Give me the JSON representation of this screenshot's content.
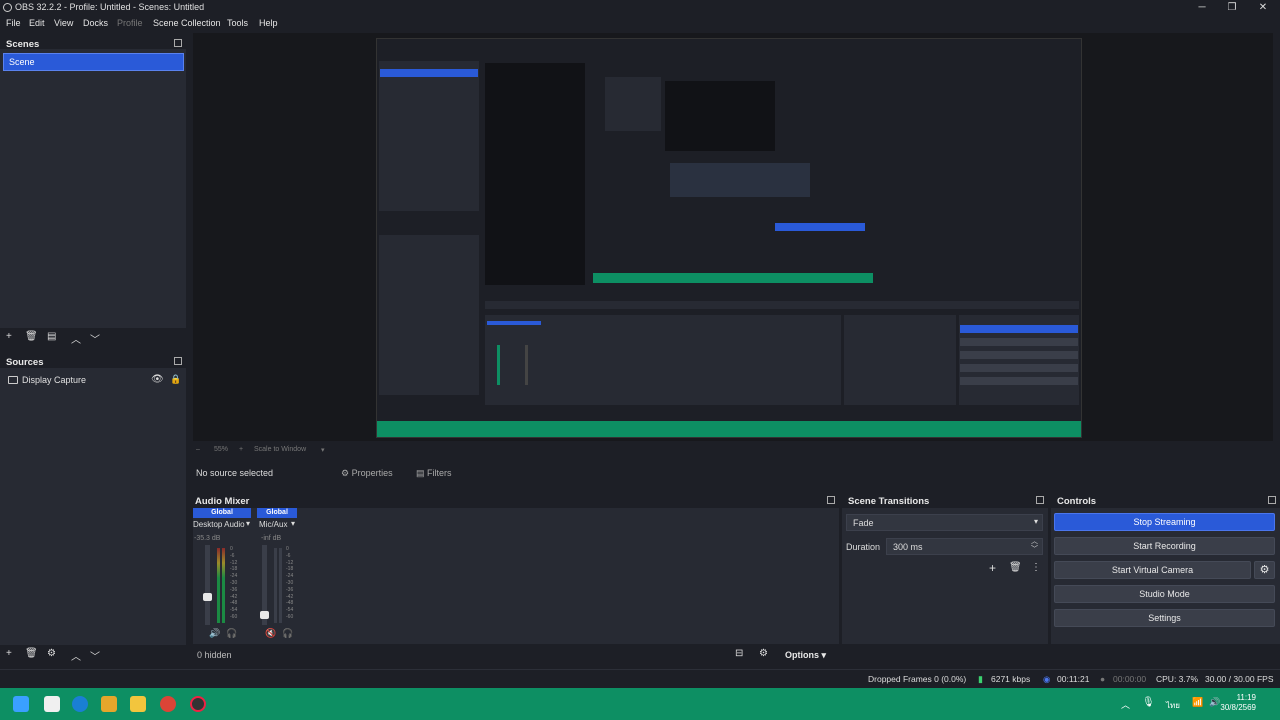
{
  "window": {
    "title": "OBS 32.2.2 - Profile: Untitled - Scenes: Untitled",
    "minimize": "─",
    "restore": "❐",
    "close": "✕"
  },
  "menu": {
    "items": [
      "File",
      "Edit",
      "View",
      "Docks",
      "Profile",
      "Scene Collection",
      "Tools",
      "Help"
    ]
  },
  "scenes": {
    "header": "Scenes",
    "items": [
      "Scene"
    ]
  },
  "sources": {
    "header": "Sources",
    "items": [
      "Display Capture"
    ]
  },
  "preview": {
    "zoom_bar": [
      "–",
      "55%",
      "+",
      "Scale to Window"
    ]
  },
  "source_bar": {
    "no_source": "No source selected",
    "properties": "Properties",
    "filters": "Filters"
  },
  "mixer": {
    "header": "Audio Mixer",
    "channels": [
      {
        "badge": "Global",
        "name": "Desktop Audio",
        "db": "-35.3 dB"
      },
      {
        "badge": "Global",
        "name": "Mic/Aux",
        "db": "-inf dB"
      }
    ],
    "meter_ticks": [
      "0",
      "-6",
      "-12",
      "-18",
      "-24",
      "-30",
      "-36",
      "-42",
      "-48",
      "-54",
      "-60"
    ],
    "hidden_label": "0 hidden",
    "options": "Options"
  },
  "transitions": {
    "header": "Scene Transitions",
    "selected": "Fade",
    "duration_label": "Duration",
    "duration_value": "300 ms"
  },
  "controls": {
    "header": "Controls",
    "stop_streaming": "Stop Streaming",
    "start_recording": "Start Recording",
    "start_virtual_camera": "Start Virtual Camera",
    "studio_mode": "Studio Mode",
    "settings": "Settings"
  },
  "status": {
    "dropped_frames": "Dropped Frames 0 (0.0%)",
    "kbps": "6271 kbps",
    "stream_time": "00:11:21",
    "record_time": "00:00:00",
    "cpu": "CPU: 3.7%",
    "fps": "30.00 / 30.00 FPS"
  },
  "taskbar": {
    "time": "11:19",
    "date": "30/8/2569",
    "lang": "ไทย"
  },
  "colors": {
    "accent": "#2a5ad8",
    "taskbar": "#0d8f63",
    "panel": "#272a33",
    "background": "#1d1f26"
  }
}
